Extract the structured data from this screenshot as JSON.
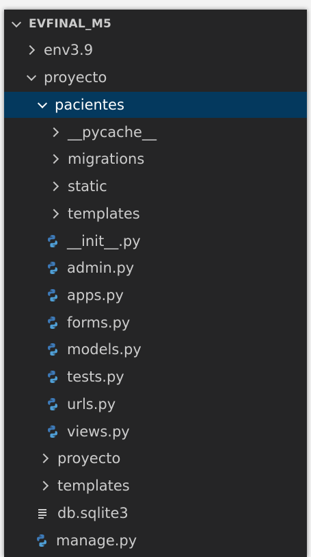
{
  "explorer": {
    "root": {
      "label": "EVFINAL_M5",
      "expanded": true
    },
    "items": [
      {
        "label": "env3.9",
        "type": "folder",
        "expanded": false
      },
      {
        "label": "proyecto",
        "type": "folder",
        "expanded": true
      },
      {
        "label": "pacientes",
        "type": "folder",
        "expanded": true,
        "selected": true
      },
      {
        "label": "__pycache__",
        "type": "folder",
        "expanded": false
      },
      {
        "label": "migrations",
        "type": "folder",
        "expanded": false
      },
      {
        "label": "static",
        "type": "folder",
        "expanded": false
      },
      {
        "label": "templates",
        "type": "folder",
        "expanded": false
      },
      {
        "label": "__init__.py",
        "type": "file",
        "icon": "python-file-icon"
      },
      {
        "label": "admin.py",
        "type": "file",
        "icon": "python-file-icon"
      },
      {
        "label": "apps.py",
        "type": "file",
        "icon": "python-file-icon"
      },
      {
        "label": "forms.py",
        "type": "file",
        "icon": "python-file-icon"
      },
      {
        "label": "models.py",
        "type": "file",
        "icon": "python-file-icon"
      },
      {
        "label": "tests.py",
        "type": "file",
        "icon": "python-file-icon"
      },
      {
        "label": "urls.py",
        "type": "file",
        "icon": "python-file-icon"
      },
      {
        "label": "views.py",
        "type": "file",
        "icon": "python-file-icon"
      },
      {
        "label": "proyecto",
        "type": "folder",
        "expanded": false
      },
      {
        "label": "templates",
        "type": "folder",
        "expanded": false
      },
      {
        "label": "db.sqlite3",
        "type": "file",
        "icon": "database-file-icon"
      },
      {
        "label": "manage.py",
        "type": "file",
        "icon": "python-file-icon"
      }
    ]
  },
  "colors": {
    "background": "#252526",
    "text": "#cccccc",
    "selection": "#04395e",
    "python_blue": "#3d7ab8",
    "python_yellow": "#4f9fd6"
  }
}
